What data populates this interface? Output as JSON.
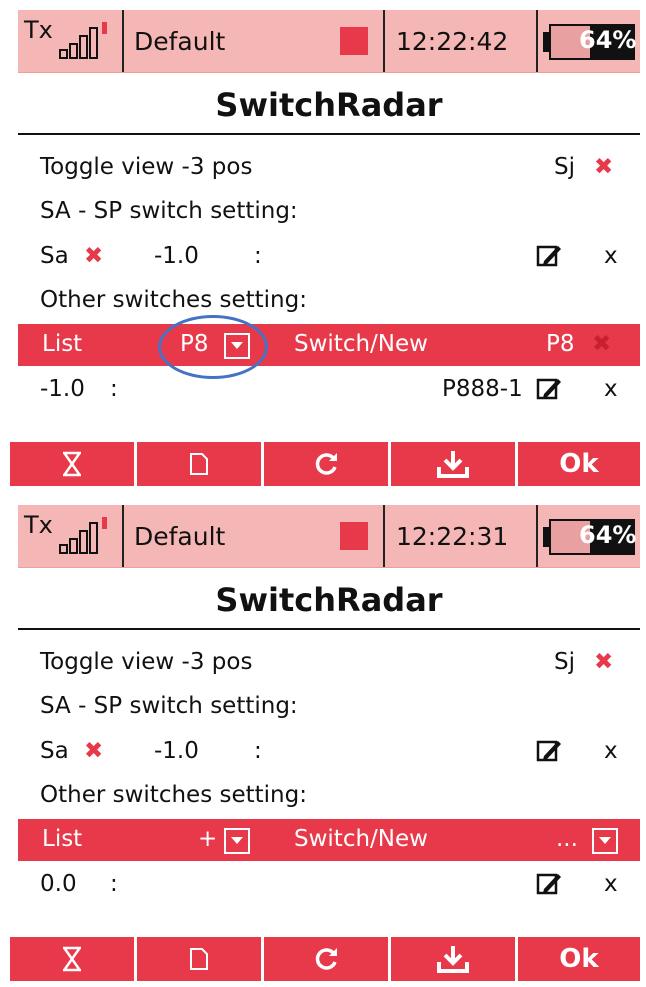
{
  "screens": [
    {
      "status": {
        "tx_label": "Tx",
        "model": "Default",
        "time": "12:22:42",
        "battery_pct": "64%",
        "battery_level": 0.64
      },
      "title": "SwitchRadar",
      "toggle": {
        "label": "Toggle view -3 pos",
        "switch": "Sj",
        "mark": "✖"
      },
      "sa_heading": "SA - SP switch setting:",
      "sa_row": {
        "switch": "Sa",
        "mark": "✖",
        "value": "-1.0",
        "colon": ":",
        "x": "x"
      },
      "other_heading": "Other switches setting:",
      "list_bar": {
        "list": "List",
        "selected": "P8",
        "switch_new": "Switch/New",
        "right": "P8",
        "right_mark": "✖"
      },
      "value_row": {
        "value": "-1.0",
        "colon": ":",
        "name": "P888-1",
        "x": "x"
      },
      "toolbar": {
        "ok": "Ok"
      }
    },
    {
      "status": {
        "tx_label": "Tx",
        "model": "Default",
        "time": "12:22:31",
        "battery_pct": "64%",
        "battery_level": 0.64
      },
      "title": "SwitchRadar",
      "toggle": {
        "label": "Toggle view -3 pos",
        "switch": "Sj",
        "mark": "✖"
      },
      "sa_heading": "SA - SP switch setting:",
      "sa_row": {
        "switch": "Sa",
        "mark": "✖",
        "value": "-1.0",
        "colon": ":",
        "x": "x"
      },
      "other_heading": "Other switches setting:",
      "list_bar": {
        "list": "List",
        "selected": "+",
        "switch_new": "Switch/New",
        "right": "..."
      },
      "value_row": {
        "value": "0.0",
        "colon": ":",
        "x": "x"
      },
      "toolbar": {
        "ok": "Ok"
      }
    }
  ],
  "icons": [
    "hourglass-icon",
    "new-file-icon",
    "refresh-icon",
    "download-icon",
    "pencil-icon",
    "signal-bars-icon",
    "battery-icon",
    "dropdown-icon"
  ],
  "colors": {
    "accent": "#e8394a",
    "status_bg": "#f5b6b6",
    "highlight_circle": "#4472c4"
  }
}
